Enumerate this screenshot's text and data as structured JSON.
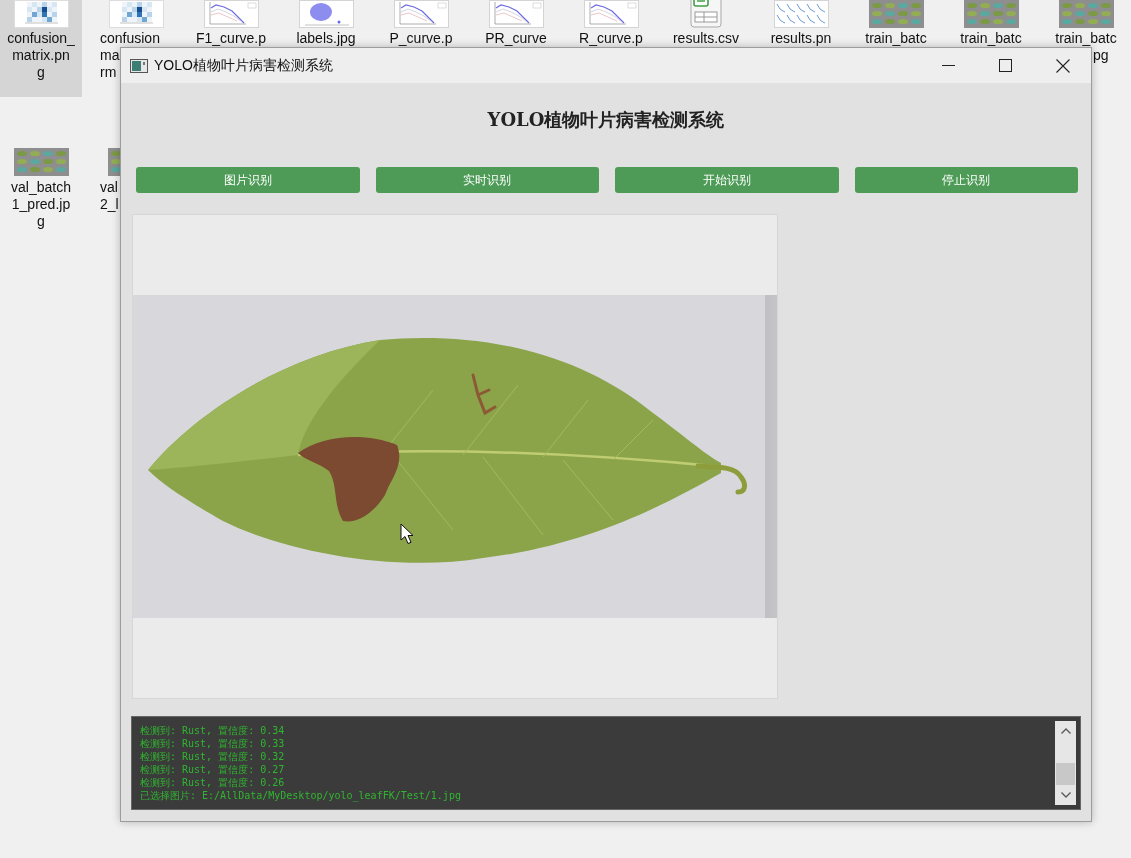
{
  "desktop": {
    "rows": [
      {
        "icons": [
          {
            "kind": "heatmap",
            "lines": [
              "confusion_",
              "matrix.pn",
              "g"
            ],
            "selected": true
          },
          {
            "kind": "heatmap",
            "lines": [
              "confusion",
              "ma",
              "rm"
            ],
            "selected": false
          },
          {
            "kind": "curve",
            "lines": [
              "F1_curve.p"
            ],
            "selected": false
          },
          {
            "kind": "scatter",
            "lines": [
              "labels.jpg"
            ],
            "selected": false
          },
          {
            "kind": "curve",
            "lines": [
              "P_curve.p"
            ],
            "selected": false
          },
          {
            "kind": "curve",
            "lines": [
              "PR_curve"
            ],
            "selected": false
          },
          {
            "kind": "curve",
            "lines": [
              "R_curve.p"
            ],
            "selected": false
          },
          {
            "kind": "spreadsheet",
            "lines": [
              "results.csv"
            ],
            "selected": false
          },
          {
            "kind": "chart-grid",
            "lines": [
              "results.pn"
            ],
            "selected": false
          },
          {
            "kind": "photo",
            "lines": [
              "train_batc"
            ],
            "selected": false
          },
          {
            "kind": "photo",
            "lines": [
              "train_batc"
            ],
            "selected": false
          },
          {
            "kind": "photo",
            "lines": [
              "train_batc",
              "pg"
            ],
            "selected": false
          }
        ]
      },
      {
        "icons": [
          {
            "kind": "photo",
            "lines": [
              "val_batch",
              "1_pred.jp",
              "g"
            ],
            "selected": false
          },
          {
            "kind": "photo",
            "lines": [
              "val",
              "2_l"
            ],
            "selected": false
          }
        ]
      }
    ]
  },
  "window": {
    "title": "YOLO植物叶片病害检测系统",
    "heading": "YOLO植物叶片病害检测系统",
    "buttons": [
      "图片识别",
      "实时识别",
      "开始识别",
      "停止识别"
    ],
    "log": {
      "lines": [
        "检测到: Rust, 置信度: 0.34",
        "检测到: Rust, 置信度: 0.33",
        "检测到: Rust, 置信度: 0.32",
        "检测到: Rust, 置信度: 0.27",
        "检测到: Rust, 置信度: 0.26",
        "已选择图片: E:/AllData/MyDesktop/yolo_leafFK/Test/1.jpg"
      ]
    }
  }
}
